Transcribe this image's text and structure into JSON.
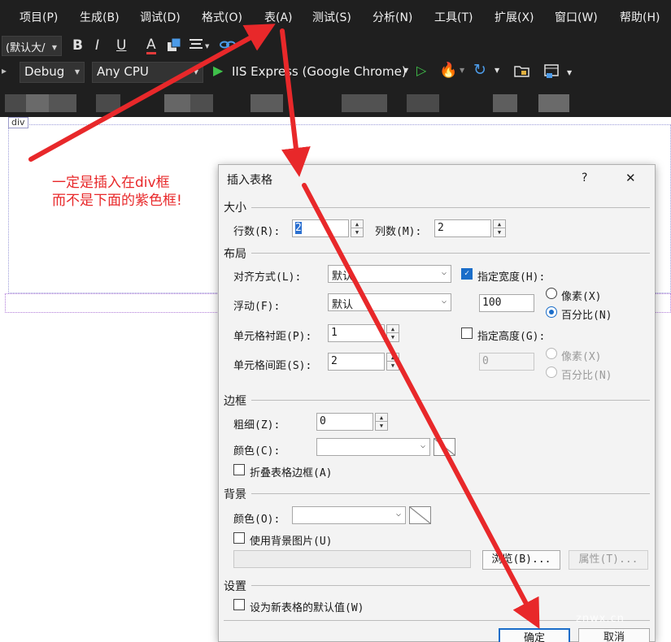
{
  "menubar": {
    "items": [
      "项目(P)",
      "生成(B)",
      "调试(D)",
      "格式(O)",
      "表(A)",
      "测试(S)",
      "分析(N)",
      "工具(T)",
      "扩展(X)",
      "窗口(W)",
      "帮助(H)"
    ]
  },
  "format_toolbar": {
    "style_dropdown": "(默认大/",
    "bold": "B",
    "italic": "I",
    "underline": "U",
    "font_color": "A"
  },
  "standard_toolbar": {
    "config": "Debug",
    "platform": "Any CPU",
    "run_target": "IIS Express (Google Chrome)"
  },
  "designer": {
    "div_tag": "div",
    "note_line1": "一定是插入在div框",
    "note_line2": "而不是下面的紫色框!"
  },
  "dialog": {
    "title": "插入表格",
    "help": "?",
    "close": "✕",
    "size": {
      "section": "大小",
      "rows_label": "行数(R):",
      "rows_value": "2",
      "cols_label": "列数(M):",
      "cols_value": "2"
    },
    "layout": {
      "section": "布局",
      "align_label": "对齐方式(L):",
      "align_value": "默认",
      "float_label": "浮动(F):",
      "float_value": "默认",
      "padding_label": "单元格衬距(P):",
      "padding_value": "1",
      "spacing_label": "单元格间距(S):",
      "spacing_value": "2",
      "width_check_label": "指定宽度(H):",
      "width_checked": true,
      "width_value": "100",
      "width_pixels": "像素(X)",
      "width_percent": "百分比(N)",
      "height_check_label": "指定高度(G):",
      "height_checked": false,
      "height_value": "0",
      "height_pixels": "像素(X)",
      "height_percent": "百分比(N)"
    },
    "border": {
      "section": "边框",
      "thickness_label": "粗细(Z):",
      "thickness_value": "0",
      "color_label": "颜色(C):",
      "collapse_label": "折叠表格边框(A)"
    },
    "background": {
      "section": "背景",
      "color_label": "颜色(O):",
      "image_label": "使用背景图片(U)",
      "browse": "浏览(B)...",
      "properties": "属性(T)..."
    },
    "settings": {
      "section": "设置",
      "default_label": "设为新表格的默认值(W)"
    },
    "ok": "确定",
    "cancel": "取消"
  },
  "colors": {
    "vs_dark": "#1f1f1f",
    "annotation_red": "#e8282a",
    "accent_blue": "#1a6dc9"
  },
  "watermark": "znwx.cn"
}
